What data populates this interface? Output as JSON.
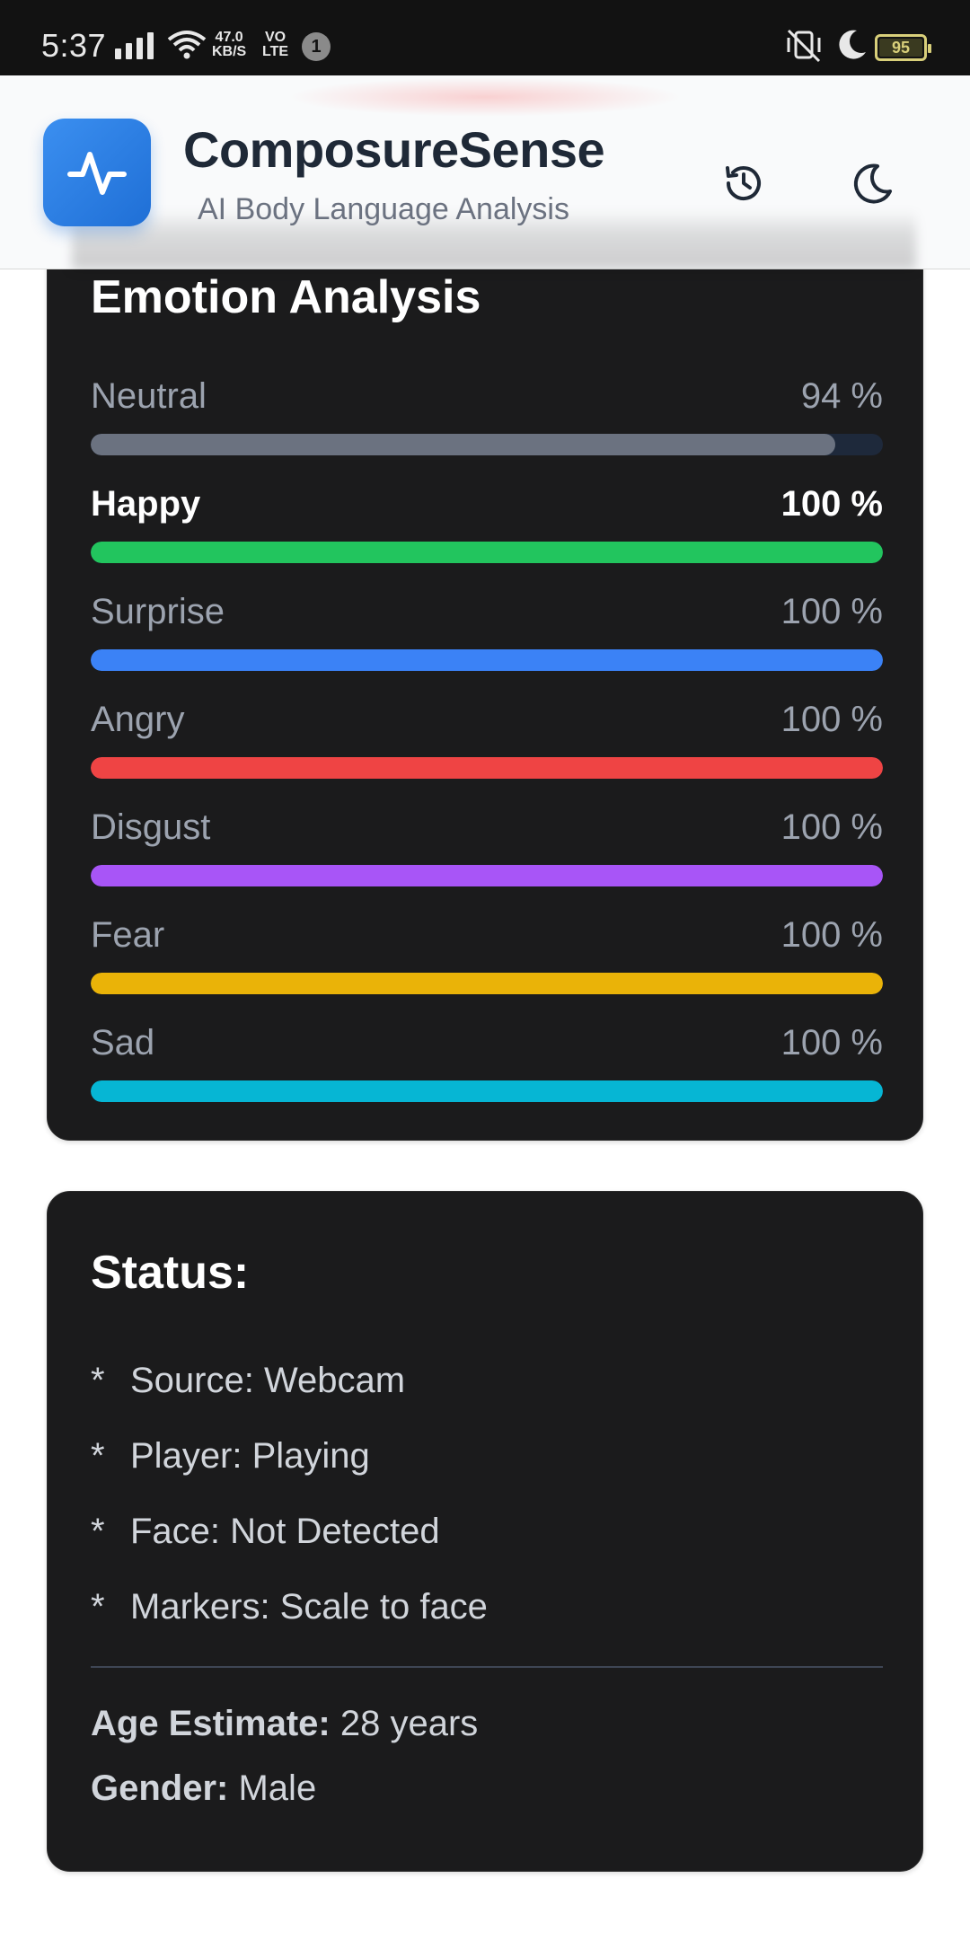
{
  "status_bar": {
    "time": "5:37",
    "net_speed_value": "47.0",
    "net_speed_unit": "KB/S",
    "volte_top": "VO",
    "volte_bottom": "LTE",
    "notification_count": "1",
    "battery": "95"
  },
  "header": {
    "title": "ComposureSense",
    "subtitle": "AI Body Language Analysis",
    "logo_icon": "pulse-icon",
    "history_icon": "history-icon",
    "theme_icon": "moon-icon",
    "accent_color": "#2680e6"
  },
  "emotion_card": {
    "title": "Emotion Analysis",
    "emotions": [
      {
        "name": "Neutral",
        "percent_label": "94 %",
        "value": 94,
        "color": "#6b7280"
      },
      {
        "name": "Happy",
        "percent_label": "100 %",
        "value": 100,
        "color": "#22c55e"
      },
      {
        "name": "Surprise",
        "percent_label": "100 %",
        "value": 100,
        "color": "#3b82f6"
      },
      {
        "name": "Angry",
        "percent_label": "100 %",
        "value": 100,
        "color": "#ef4444"
      },
      {
        "name": "Disgust",
        "percent_label": "100 %",
        "value": 100,
        "color": "#a855f7"
      },
      {
        "name": "Fear",
        "percent_label": "100 %",
        "value": 100,
        "color": "#eab308"
      },
      {
        "name": "Sad",
        "percent_label": "100 %",
        "value": 100,
        "color": "#06b6d4"
      }
    ],
    "track_color": "#1e293b"
  },
  "status_card": {
    "title": "Status:",
    "bullet": "*",
    "items": [
      "Source: Webcam",
      "Player: Playing",
      "Face: Not Detected",
      "Markers: Scale to face"
    ],
    "age_label": "Age Estimate:",
    "age_value": "28 years",
    "gender_label": "Gender:",
    "gender_value": "Male"
  }
}
